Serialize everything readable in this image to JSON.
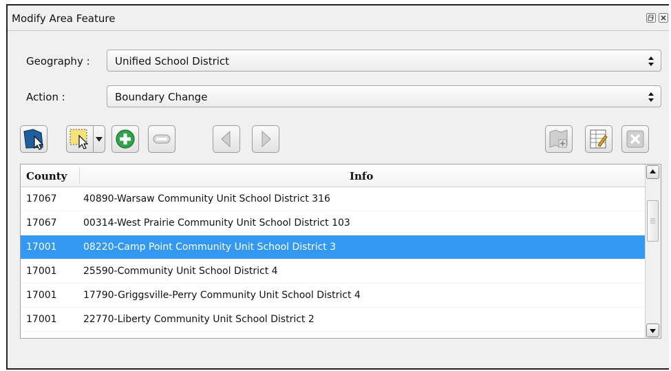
{
  "window": {
    "title": "Modify Area Feature",
    "float_icon": "float-icon",
    "close_icon": "close-icon"
  },
  "form": {
    "geography_label": "Geography :",
    "geography_value": "Unified School District",
    "action_label": "Action :",
    "action_value": "Boundary Change"
  },
  "toolbar": {
    "left_icons": [
      "select-feature-icon",
      "rectangle-select-icon",
      "chevron-down-icon",
      "add-icon",
      "remove-icon",
      "previous-icon",
      "next-icon"
    ],
    "right_icons": [
      "map-add-icon",
      "edit-table-icon",
      "clear-icon"
    ],
    "colors": {
      "select_blue": "#1f5f9c",
      "add_green": "#2fa44a",
      "highlight_yellow": "#f5e27a",
      "disabled_gray": "#b5b5b5"
    }
  },
  "table": {
    "columns": [
      "County",
      "Info"
    ],
    "rows": [
      {
        "county": "17067",
        "info": "40890-Warsaw Community Unit School District 316",
        "selected": false
      },
      {
        "county": "17067",
        "info": "00314-West Prairie Community Unit School District 103",
        "selected": false
      },
      {
        "county": "17001",
        "info": "08220-Camp Point Community Unit School District 3",
        "selected": true
      },
      {
        "county": "17001",
        "info": "25590-Community Unit School District 4",
        "selected": false
      },
      {
        "county": "17001",
        "info": "17790-Griggsville-Perry Community Unit School District 4",
        "selected": false
      },
      {
        "county": "17001",
        "info": "22770-Liberty Community Unit School District 2",
        "selected": false
      }
    ],
    "selection_color": "#3399f0"
  }
}
